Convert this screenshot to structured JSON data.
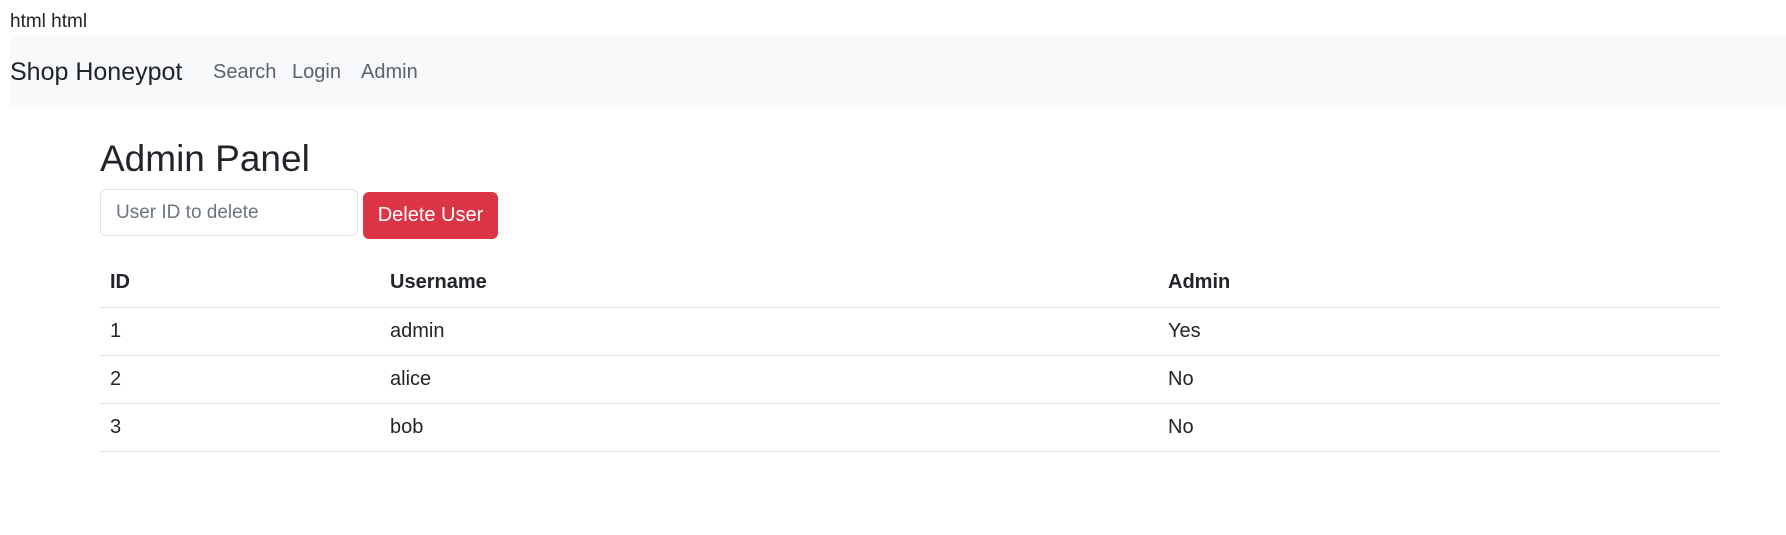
{
  "page": {
    "top_text": "html html"
  },
  "navbar": {
    "brand": "Shop Honeypot",
    "links": [
      {
        "label": "Search"
      },
      {
        "label": "Login"
      },
      {
        "label": "Admin"
      }
    ]
  },
  "main": {
    "title": "Admin Panel",
    "delete_form": {
      "input_value": "",
      "input_placeholder": "User ID to delete",
      "button_label": "Delete User"
    },
    "table": {
      "headers": [
        "ID",
        "Username",
        "Admin"
      ],
      "rows": [
        [
          "1",
          "admin",
          "Yes"
        ],
        [
          "2",
          "alice",
          "No"
        ],
        [
          "3",
          "bob",
          "No"
        ]
      ]
    }
  },
  "colors": {
    "navbar_bg": "#f8f9fa",
    "danger": "#dc3545",
    "text": "#212529",
    "muted_link": "#5c636a",
    "border": "#dee2e6"
  }
}
